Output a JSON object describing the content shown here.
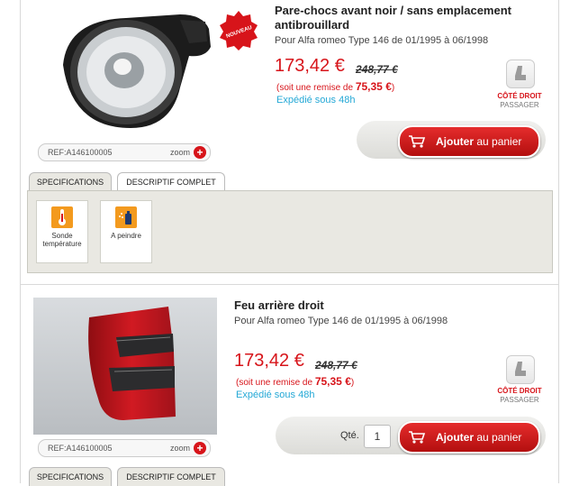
{
  "products": [
    {
      "badge": "NOUVEAU",
      "title": "Pare-chocs avant noir / sans emplacement antibrouillard",
      "subtitle": "Pour Alfa romeo Type 146 de 01/1995 à 06/1998",
      "price": "173,42 €",
      "old_price": "248,77 €",
      "remise_prefix": "(soit une remise de ",
      "remise_value": "75,35 €",
      "remise_suffix": ")",
      "shipping": "Expédié sous 48h",
      "side_primary": "CÔTÉ DROIT",
      "side_secondary": "PASSAGER",
      "ref": "REF:A146100005",
      "zoom": "zoom",
      "cart_bold": "Ajouter",
      "cart_rest": " au panier",
      "tabs": [
        "SPECIFICATIONS",
        "DESCRIPTIF COMPLET"
      ],
      "specs": [
        {
          "label": "Sonde température",
          "icon": "thermometer-icon"
        },
        {
          "label": "A peindre",
          "icon": "paint-spray-icon"
        }
      ]
    },
    {
      "title": "Feu arrière droit",
      "subtitle": "Pour Alfa romeo Type 146 de 01/1995 à 06/1998",
      "price": "173,42 €",
      "old_price": "248,77 €",
      "remise_prefix": "(soit une remise de ",
      "remise_value": "75,35 €",
      "remise_suffix": ")",
      "shipping": "Expédié sous 48h",
      "side_primary": "CÔTÉ DROIT",
      "side_secondary": "PASSAGER",
      "ref": "REF:A146100005",
      "zoom": "zoom",
      "qty_label": "Qté.",
      "qty_value": "1",
      "cart_bold": "Ajouter",
      "cart_rest": " au panier",
      "tabs": [
        "SPECIFICATIONS",
        "DESCRIPTIF COMPLET"
      ]
    }
  ],
  "colors": {
    "accent_red": "#d7141a",
    "shipping_blue": "#24a8d6",
    "spec_orange": "#f39a1e",
    "panel_bg": "#e9e8e2"
  }
}
